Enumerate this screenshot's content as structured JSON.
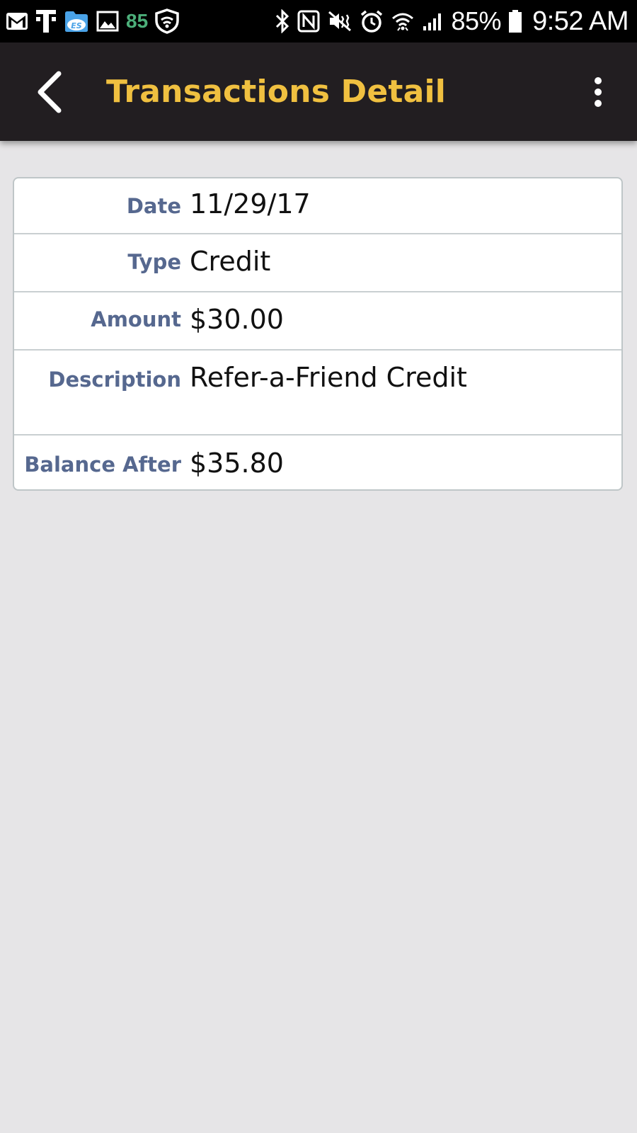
{
  "status_bar": {
    "notification_count": "85",
    "battery_percent": "85%",
    "time": "9:52 AM",
    "left_icons": [
      "gmail-icon",
      "tmobile-icon",
      "es-file-explorer-icon",
      "gallery-icon",
      "shield-icon"
    ],
    "right_icons": [
      "bluetooth-icon",
      "nfc-icon",
      "vibrate-icon",
      "alarm-icon",
      "wifi-icon",
      "signal-icon",
      "battery-icon"
    ]
  },
  "app_bar": {
    "title": "Transactions Detail",
    "title_color": "#f0c040",
    "background_color": "#221e21",
    "back_icon": "back-arrow-icon",
    "menu_icon": "more-vert-icon"
  },
  "transaction": {
    "date_label": "Date",
    "date_value": "11/29/17",
    "type_label": "Type",
    "type_value": "Credit",
    "amount_label": "Amount",
    "amount_value": "$30.00",
    "description_label": "Description",
    "description_value": "Refer-a-Friend Credit",
    "balance_label": "Balance After",
    "balance_value": "$35.80",
    "label_color": "#56688f"
  }
}
